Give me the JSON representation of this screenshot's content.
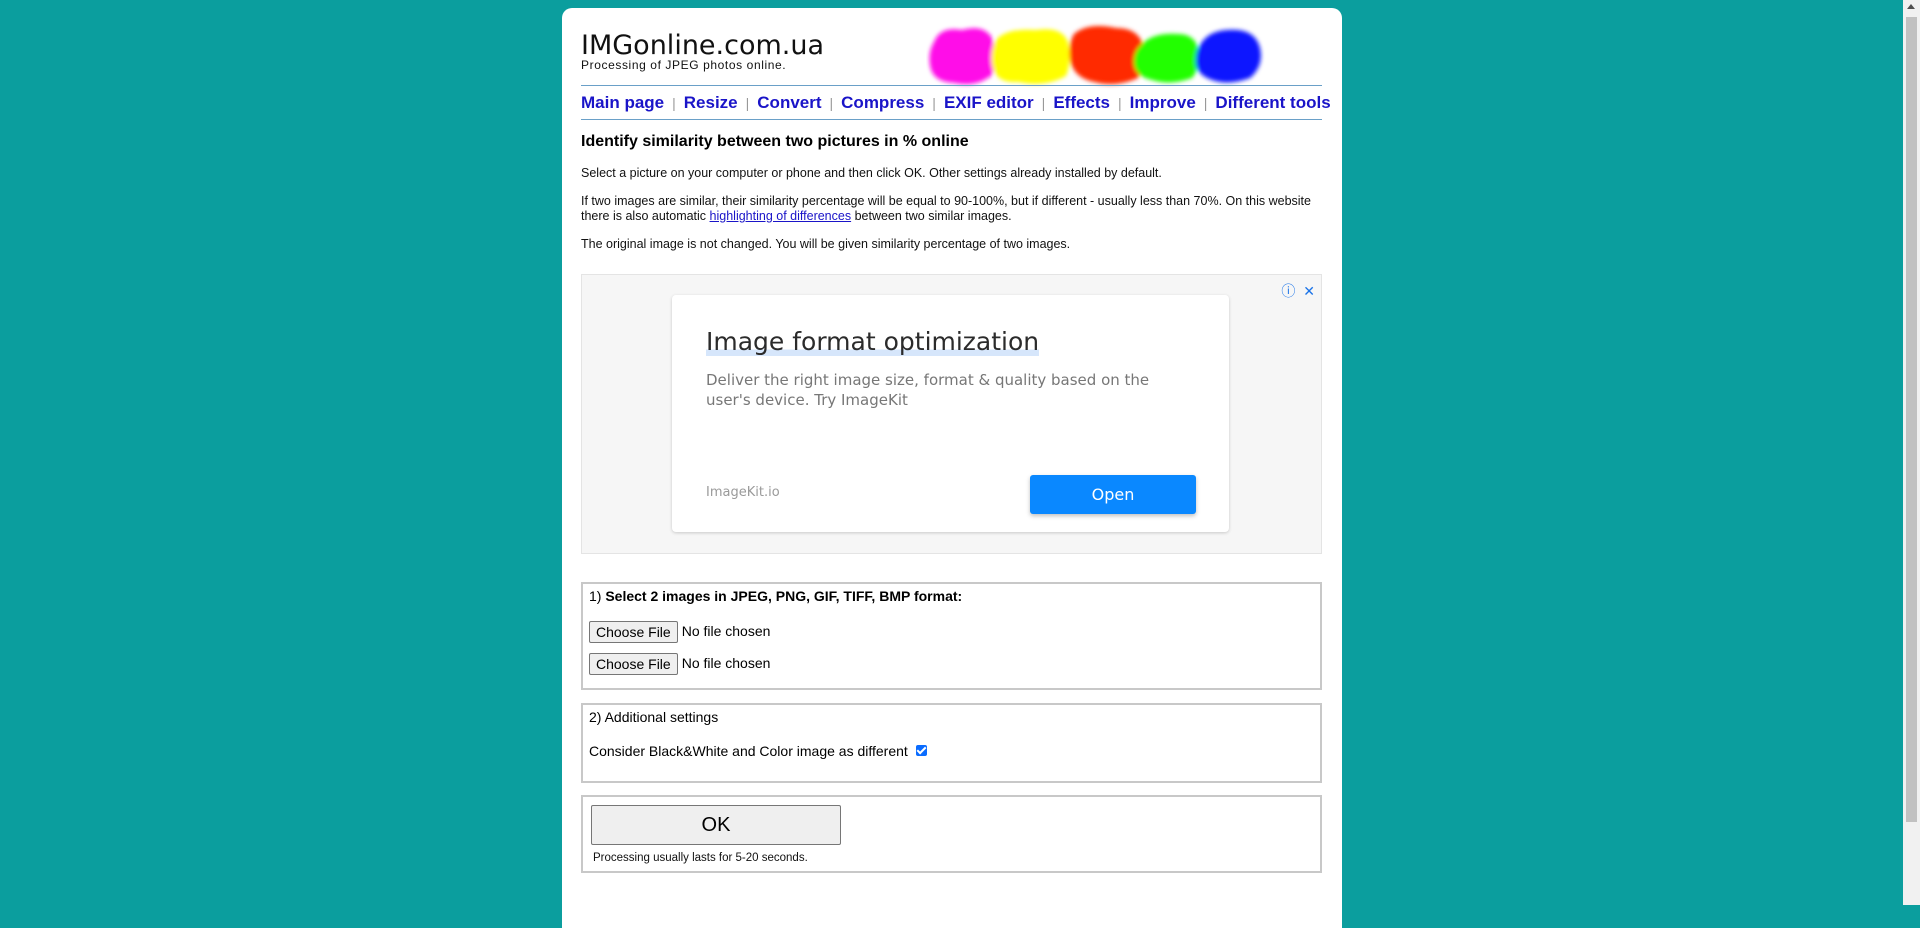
{
  "header": {
    "site_title": "IMGonline.com.ua",
    "subtitle": "Processing of JPEG photos online."
  },
  "blobs": {
    "colors": [
      "#ff10e8",
      "#ffff00",
      "#ff2a00",
      "#22ff00",
      "#0a14ff"
    ]
  },
  "nav": {
    "items": [
      "Main page",
      "Resize",
      "Convert",
      "Compress",
      "EXIF editor",
      "Effects",
      "Improve",
      "Different tools"
    ],
    "separator": "|"
  },
  "main": {
    "heading": "Identify similarity between two pictures in % online",
    "para1": "Select a picture on your computer or phone and then click OK. Other settings already installed by default.",
    "para2_before": "If two images are similar, their similarity percentage will be equal to 90-100%, but if different - usually less than 70%. On this website there is also automatic ",
    "para2_link": "highlighting of differences",
    "para2_after": " between two similar images.",
    "para3": "The original image is not changed. You will be given similarity percentage of two images."
  },
  "ad": {
    "title": "Image format optimization",
    "description": "Deliver the right image size, format & quality based on the user's device. Try ImageKit",
    "source": "ImageKit.io",
    "button_label": "Open",
    "info_icon": "ⓘ",
    "close_icon": "✕"
  },
  "section1": {
    "prefix": "1) ",
    "title": "Select 2 images in JPEG, PNG, GIF, TIFF, BMP format:",
    "file_button_label": "Choose File",
    "file_status": "No file chosen"
  },
  "section2": {
    "title": "2) Additional settings",
    "option_label": "Consider Black&White and Color image as different",
    "option_checked": true
  },
  "submit": {
    "button_label": "OK",
    "note": "Processing usually lasts for 5-20 seconds."
  }
}
